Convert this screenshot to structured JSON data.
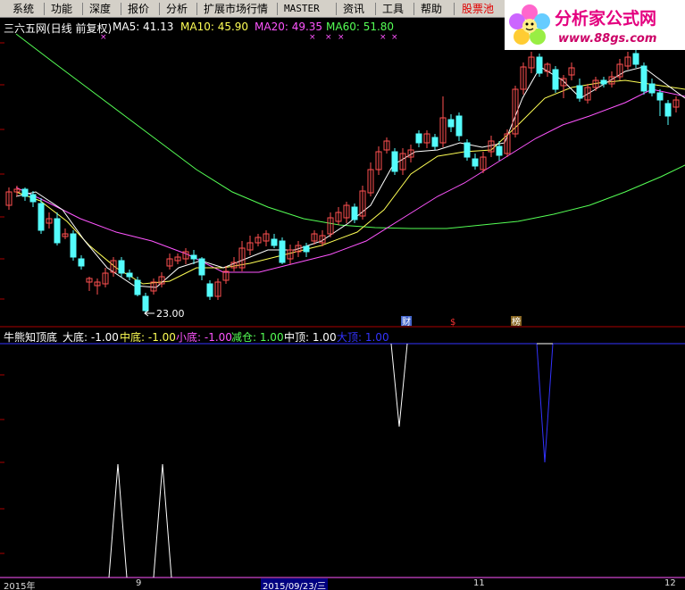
{
  "menu": {
    "items": [
      "系统",
      "功能",
      "深度",
      "报价",
      "分析",
      "扩展市场行情",
      "MASTER",
      "资讯",
      "工具",
      "帮助"
    ],
    "highlight": "股票池"
  },
  "logo": {
    "title": "分析家公式网",
    "url": "www.88gs.com"
  },
  "main_legend": {
    "title": "三六五网(日线 前复权)",
    "ma": [
      {
        "label": "MA5: 41.13",
        "color": "#ffffff"
      },
      {
        "label": "MA10: 45.90",
        "color": "#ffff55"
      },
      {
        "label": "MA20: 49.35",
        "color": "#ff55ff"
      },
      {
        "label": "MA60: 51.80",
        "color": "#55ff55"
      }
    ]
  },
  "low_annotation": "23.00",
  "event_tags": [
    "财",
    "$",
    "榜"
  ],
  "indicator_legend": {
    "title": "牛熊知顶底",
    "items": [
      {
        "label": "大底: -1.00",
        "color": "#ffffff"
      },
      {
        "label": "中底: -1.00",
        "color": "#ffff55"
      },
      {
        "label": "小底: -1.00",
        "color": "#ff55ff"
      },
      {
        "label": "减仓: 1.00",
        "color": "#55ff55"
      },
      {
        "label": "中顶: 1.00",
        "color": "#ffffff"
      },
      {
        "label": "大顶: 1.00",
        "color": "#3333ff"
      }
    ]
  },
  "date_axis": [
    "2015年",
    "9",
    "2015/09/23/三",
    "11",
    "12"
  ],
  "colors": {
    "up": "#ff5050",
    "down": "#54fcfc",
    "ma5": "#ffffff",
    "ma10": "#ffff55",
    "ma20": "#ff55ff",
    "ma60": "#55ff55",
    "signal_blue": "#3333ff"
  }
}
